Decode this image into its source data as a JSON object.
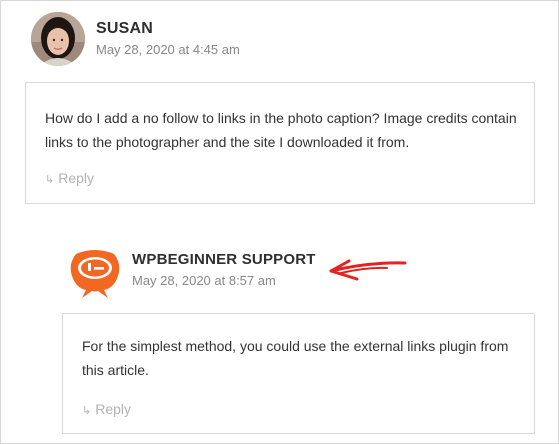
{
  "comments": [
    {
      "author": "SUSAN",
      "date": "May 28, 2020 at 4:45 am",
      "text": "How do I add a no follow to links in the photo caption? Image credits contain links to the photographer and the site I downloaded it from.",
      "reply_label": "Reply",
      "avatar_icon": "user-photo"
    },
    {
      "author": "WPBEGINNER SUPPORT",
      "date": "May 28, 2020 at 8:57 am",
      "text": "For the simplest method, you could use the external links plugin from this article.",
      "reply_label": "Reply",
      "avatar_icon": "wpbeginner-logo-icon"
    }
  ],
  "reply_icon": "reply-arrow-icon",
  "colors": {
    "brand_orange": "#f26722",
    "annotation_red": "#e4231f",
    "muted_text": "#b3b3b3"
  }
}
